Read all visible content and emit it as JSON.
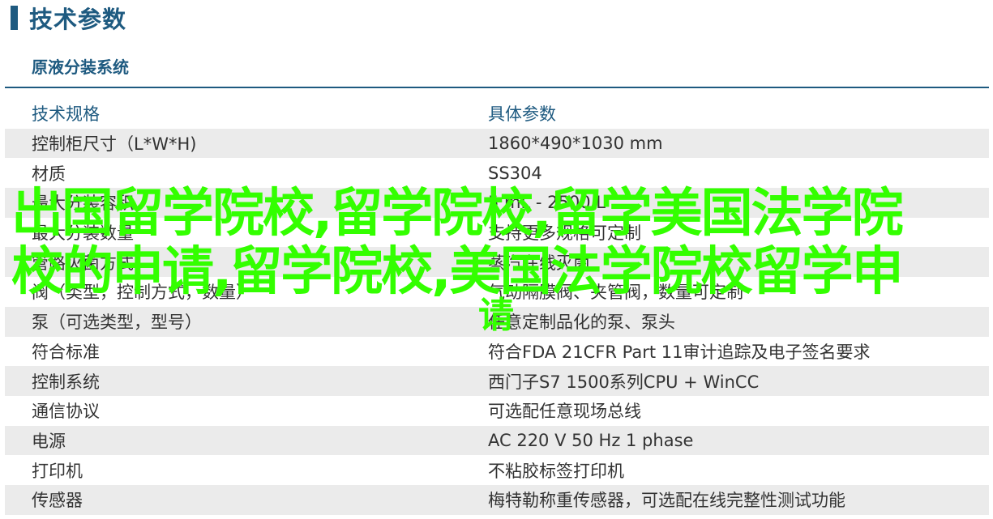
{
  "page": {
    "heading": "技术参数",
    "section_title": "原液分装系统"
  },
  "table": {
    "header": {
      "key": "技术规格",
      "value": "具体参数"
    },
    "rows": [
      {
        "key": "控制柜尺寸（L*W*H)",
        "value": "1860*490*1030 mm"
      },
      {
        "key": "材质",
        "value": "SS304"
      },
      {
        "key": "最大分装容积",
        "value": "5 mL - 2500 L"
      },
      {
        "key": "最大分装数量",
        "value": "支持更多规格可定制"
      },
      {
        "key": "管路灭菌方式",
        "value": "蒸汽在线灭菌"
      },
      {
        "key": "阀（类型，控制方式，数量）",
        "value": "气动隔膜阀、夹管阀，数量可定制"
      },
      {
        "key": "泵（可选类型，型号）",
        "value": "任意定制品化的泵、泵头"
      },
      {
        "key": "符合标准",
        "value": "符合FDA 21CFR Part 11审计追踪及电子签名要求"
      },
      {
        "key": "控制系统",
        "value": "西门子S7 1500系列CPU + WinCC"
      },
      {
        "key": "通信协议",
        "value": "可选配任意现场总线"
      },
      {
        "key": "电源",
        "value": "AC 220 V 50 Hz 1 phase"
      },
      {
        "key": "打印机",
        "value": "不粘胶标签打印机"
      },
      {
        "key": "传感器",
        "value": "梅特勒称重传感器，可选配在线完整性测试功能"
      }
    ]
  },
  "watermark": {
    "text": "出国留学院校,留学院校,留学美国法学院校的申请,留学院校,美国法学院校留学申",
    "tail": "请"
  },
  "colors": {
    "accent": "#1e5a80",
    "row_stripe": "#ebebeb",
    "watermark": "#33ff00"
  }
}
